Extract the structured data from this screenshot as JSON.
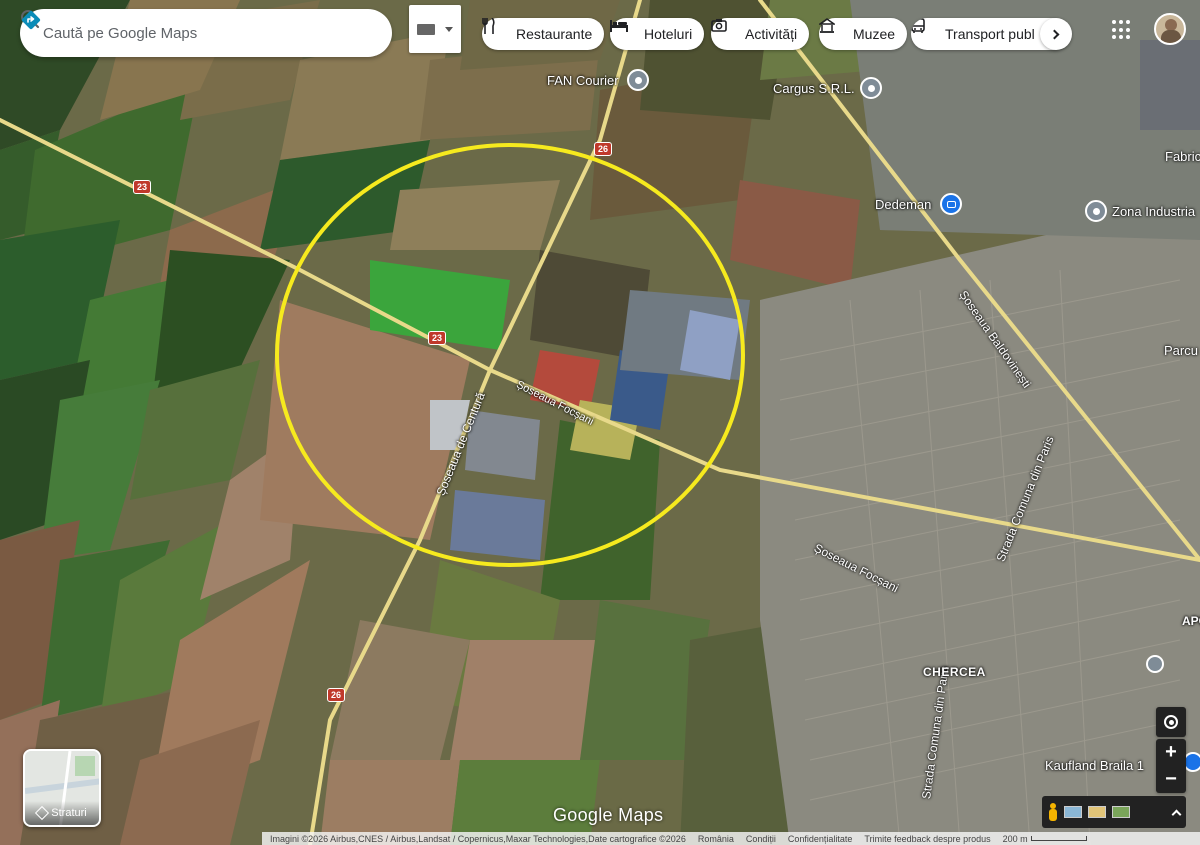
{
  "search": {
    "placeholder": "Caută pe Google Maps"
  },
  "categories": [
    {
      "label": "Restaurante",
      "icon": "fork-knife-icon"
    },
    {
      "label": "Hoteluri",
      "icon": "bed-icon"
    },
    {
      "label": "Activități",
      "icon": "camera-icon"
    },
    {
      "label": "Muzee",
      "icon": "museum-icon"
    },
    {
      "label": "Transport publ",
      "icon": "bus-icon"
    }
  ],
  "places": {
    "fan_courier": "FAN Courier",
    "cargus": "Cargus S.R.L.",
    "fabric": "Fabric",
    "dedeman": "Dedeman",
    "zona": "Zona Industria",
    "parcu": "Parcu",
    "apc": "APC",
    "chercea": "CHERCEA",
    "kaufland": "Kaufland Braila 1"
  },
  "roads": {
    "centura": "Șoseaua de Centură",
    "focsani_1": "Șoseaua Focșani",
    "focsani_2": "Șoseaua Focșani",
    "baldovinesti": "Șoseaua Baldovinești",
    "paris_1": "Strada Comuna din Paris",
    "paris_2": "Strada Comuna din Paris",
    "r23_a": "23",
    "r23_b": "23",
    "r26_a": "26",
    "r26_b": "26"
  },
  "layers": {
    "label": "Straturi"
  },
  "watermark": "Google Maps",
  "footer": {
    "attribution": "Imagini ©2026 Airbus,CNES / Airbus,Landsat / Copernicus,Maxar Technologies,Date cartografice ©2026",
    "country": "România",
    "terms": "Condiții",
    "privacy": "Confidențialitate",
    "feedback": "Trimite feedback despre produs",
    "scale": "200 m"
  },
  "colors": {
    "highlight_circle": "#f6ea1e",
    "poi_blue": "#1a73e8",
    "poi_gray": "#7f8c97",
    "directions": "#0b8cb8"
  }
}
